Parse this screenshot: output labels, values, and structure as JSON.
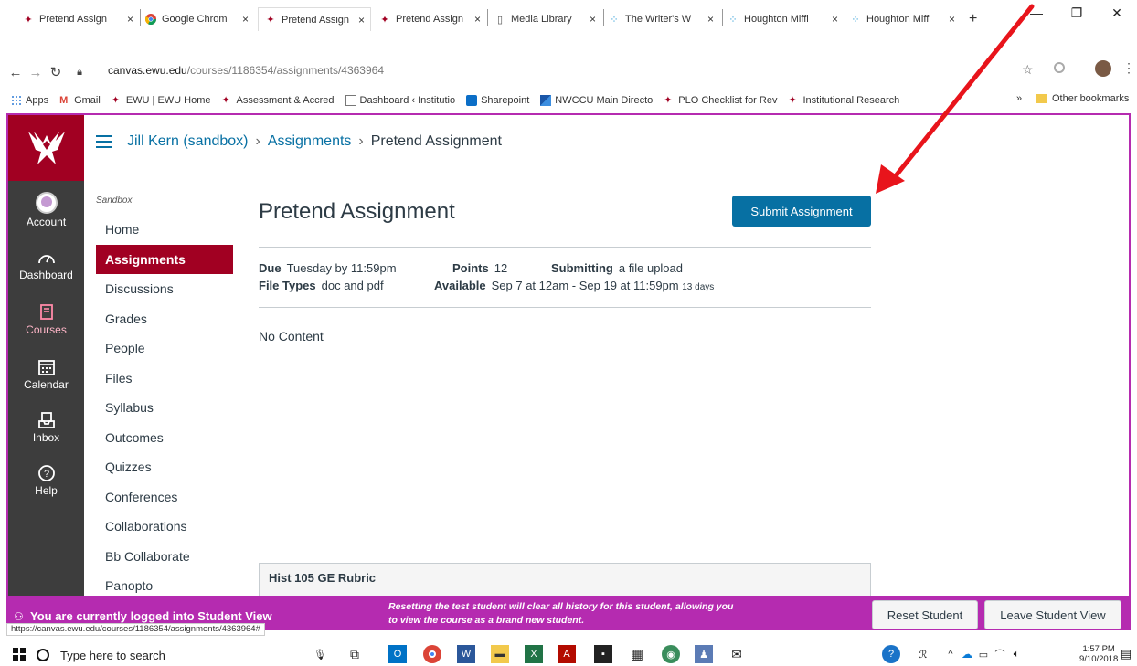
{
  "browser": {
    "tabs": [
      {
        "label": "Pretend Assign",
        "icon": "eagle-icon"
      },
      {
        "label": "Google Chrom",
        "icon": "chrome-icon"
      },
      {
        "label": "Pretend Assign",
        "icon": "eagle-icon"
      },
      {
        "label": "Pretend Assign",
        "icon": "eagle-icon"
      },
      {
        "label": "Media Library",
        "icon": "page-icon"
      },
      {
        "label": "The Writer's W",
        "icon": "dots-icon"
      },
      {
        "label": "Houghton Miffl",
        "icon": "dots-icon"
      },
      {
        "label": "Houghton Miffl",
        "icon": "dots-icon"
      }
    ],
    "tab_close": "×",
    "new_tab": "+",
    "url_host": "canvas.ewu.edu",
    "url_path": "/courses/1186354/assignments/4363964",
    "bookmarks": [
      "Apps",
      "Gmail",
      "EWU | EWU Home",
      "Assessment & Accred",
      "Dashboard ‹ Institutio",
      "Sharepoint",
      "NWCCU Main Directo",
      "PLO Checklist for Rev",
      "Institutional Research"
    ],
    "bookmarks_overflow": "»",
    "other_bookmarks": "Other bookmarks"
  },
  "global_nav": [
    {
      "label": "Account",
      "icon": "avatar-icon"
    },
    {
      "label": "Dashboard",
      "icon": "dashboard-icon"
    },
    {
      "label": "Courses",
      "icon": "book-icon"
    },
    {
      "label": "Calendar",
      "icon": "calendar-icon"
    },
    {
      "label": "Inbox",
      "icon": "inbox-icon"
    },
    {
      "label": "Help",
      "icon": "help-icon"
    }
  ],
  "breadcrumb": {
    "course": "Jill Kern (sandbox)",
    "section": "Assignments",
    "current": "Pretend Assignment",
    "separator": "›"
  },
  "course_nav": {
    "heading": "Sandbox",
    "items": [
      "Home",
      "Assignments",
      "Discussions",
      "Grades",
      "People",
      "Files",
      "Syllabus",
      "Outcomes",
      "Quizzes",
      "Conferences",
      "Collaborations",
      "Bb Collaborate",
      "Panopto"
    ]
  },
  "assignment": {
    "title": "Pretend Assignment",
    "submit_label": "Submit Assignment",
    "due_label": "Due",
    "due_value": "Tuesday by 11:59pm",
    "points_label": "Points",
    "points_value": "12",
    "submitting_label": "Submitting",
    "submitting_value": "a file upload",
    "filetypes_label": "File Types",
    "filetypes_value": "doc and pdf",
    "available_label": "Available",
    "available_value": "Sep 7 at 12am - Sep 19 at 11:59pm",
    "available_days": "13 days",
    "body": "No Content",
    "rubric_title": "Hist 105 GE Rubric"
  },
  "student_view": {
    "message": "You are currently logged into Student View",
    "note_line1": "Resetting the test student will clear all history for this student, allowing you",
    "note_line2": "to view the course as a brand new student.",
    "reset_label": "Reset Student",
    "leave_label": "Leave Student View",
    "status_url": "https://canvas.ewu.edu/courses/1186354/assignments/4363964#"
  },
  "taskbar": {
    "search_placeholder": "Type here to search",
    "time": "1:57 PM",
    "date": "9/10/2018"
  },
  "colors": {
    "canvas_red": "#a10022",
    "link_blue": "#0770a3",
    "student_view_purple": "#b52bb0",
    "nav_dark": "#3d3d3d",
    "annotation_arrow": "#e8141b"
  }
}
